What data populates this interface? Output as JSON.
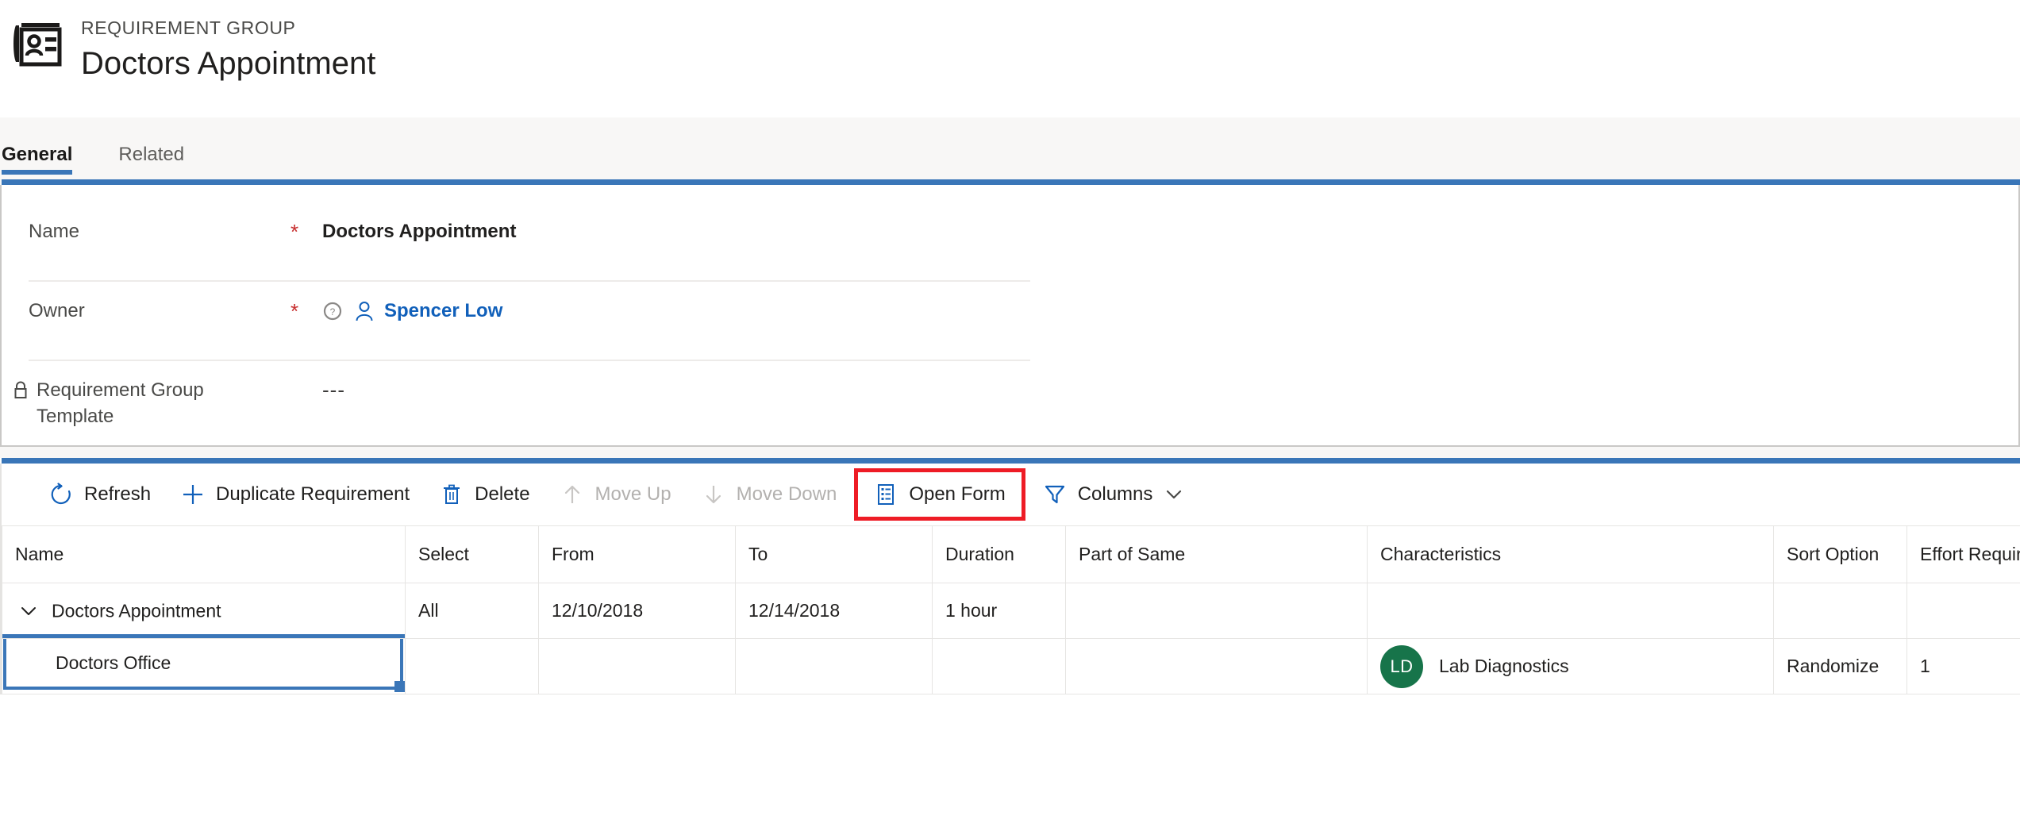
{
  "header": {
    "entity_icon": "contact-card-icon",
    "entity_type": "REQUIREMENT GROUP",
    "record_title": "Doctors Appointment"
  },
  "tabs": [
    {
      "label": "General",
      "active": true
    },
    {
      "label": "Related",
      "active": false
    }
  ],
  "form": {
    "accent_color": "#3a76b8",
    "fields": [
      {
        "label": "Name",
        "required_marker": "*",
        "value": "Doctors Appointment",
        "type": "text",
        "locked": false
      },
      {
        "label": "Owner",
        "required_marker": "*",
        "value": "Spencer Low",
        "type": "lookup",
        "locked": false,
        "info_icon": "info-circle-icon",
        "person_icon": "person-icon"
      },
      {
        "label": "Requirement Group Template",
        "required_marker": "",
        "value": "---",
        "type": "text",
        "locked": true,
        "lock_icon": "lock-icon"
      }
    ]
  },
  "command_bar": {
    "commands": [
      {
        "label": "Refresh",
        "icon": "refresh-icon",
        "disabled": false,
        "highlighted": false,
        "has_chevron": false
      },
      {
        "label": "Duplicate Requirement",
        "icon": "plus-icon",
        "disabled": false,
        "highlighted": false,
        "has_chevron": false
      },
      {
        "label": "Delete",
        "icon": "trash-icon",
        "disabled": false,
        "highlighted": false,
        "has_chevron": false
      },
      {
        "label": "Move Up",
        "icon": "arrow-up-icon",
        "disabled": true,
        "highlighted": false,
        "has_chevron": false
      },
      {
        "label": "Move Down",
        "icon": "arrow-down-icon",
        "disabled": true,
        "highlighted": false,
        "has_chevron": false
      },
      {
        "label": "Open Form",
        "icon": "form-list-icon",
        "disabled": false,
        "highlighted": true,
        "has_chevron": false
      },
      {
        "label": "Columns",
        "icon": "filter-funnel-icon",
        "disabled": false,
        "highlighted": false,
        "has_chevron": true
      }
    ],
    "highlight_color": "#ee1c25"
  },
  "grid": {
    "columns": [
      "Name",
      "Select",
      "From",
      "To",
      "Duration",
      "Part of Same",
      "Characteristics",
      "Sort Option",
      "Effort Require"
    ],
    "rows": [
      {
        "kind": "parent",
        "expander_icon": "chevron-down-icon",
        "name": "Doctors Appointment",
        "select": "All",
        "from": "12/10/2018",
        "to": "12/14/2018",
        "duration": "1 hour",
        "part_of_same": "",
        "characteristic": "",
        "characteristic_initials": "",
        "sort_option": "",
        "effort_required": "",
        "selected_underline": true
      },
      {
        "kind": "child",
        "expander_icon": "",
        "name": "Doctors Office",
        "select": "",
        "from": "",
        "to": "",
        "duration": "",
        "part_of_same": "",
        "characteristic": "Lab Diagnostics",
        "characteristic_initials": "LD",
        "characteristic_avatar_color": "#17744a",
        "sort_option": "Randomize",
        "effort_required": "1",
        "cell_editing": true
      }
    ]
  }
}
